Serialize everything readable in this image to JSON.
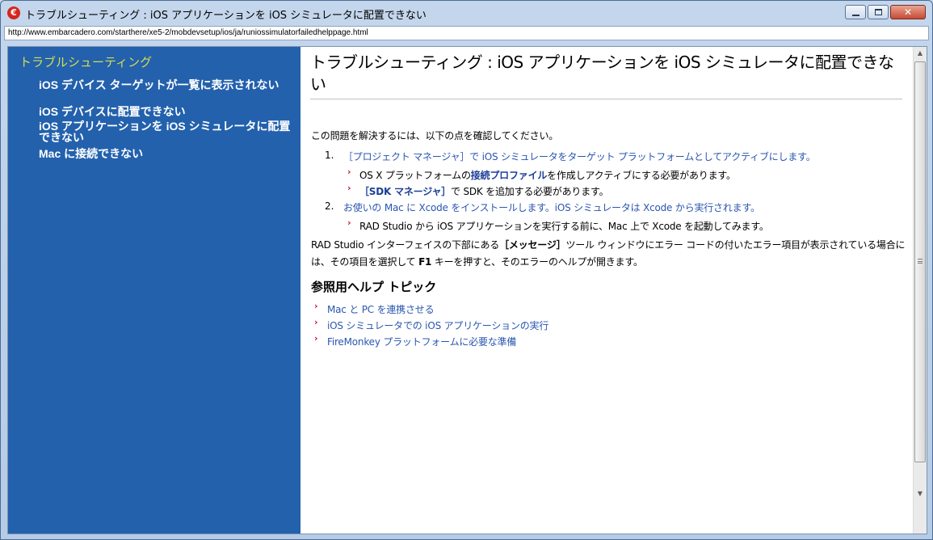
{
  "window": {
    "title": "トラブルシューティング : iOS アプリケーションを iOS シミュレータに配置できない",
    "address": "http://www.embarcadero.com/starthere/xe5-2/mobdevsetup/ios/ja/runiossimulatorfailedhelppage.html",
    "app_icon_glyph": "€",
    "minimize_label": "",
    "maximize_label": "",
    "close_label": "✕"
  },
  "sidebar": {
    "title": "トラブルシューティング",
    "items": [
      {
        "label": "iOS デバイス ターゲットが一覧に表示されない"
      },
      {
        "label": "iOS デバイスに配置できない"
      },
      {
        "label": "iOS アプリケーションを iOS シミュレータに配置できない"
      },
      {
        "label": "Mac に接続できない"
      }
    ],
    "colors": {
      "background": "#2361ad",
      "title": "#d5dd52",
      "items": "#ffffff"
    }
  },
  "main": {
    "page_title": "トラブルシューティング : iOS アプリケーションを iOS シミュレータに配置できない",
    "intro": "この問題を解決するには、以下の点を確認してください。",
    "steps": [
      {
        "number": "1.",
        "text": "［プロジェクト マネージャ］で iOS シミュレータをターゲット プラットフォームとしてアクティブにします。",
        "subitems": [
          {
            "prefix": "OS X プラットフォームの",
            "link": "接続プロファイル",
            "suffix": "を作成しアクティブにする必要があります。"
          },
          {
            "prefix": "",
            "link": "［SDK マネージャ］",
            "suffix": "で SDK を追加する必要があります。"
          }
        ]
      },
      {
        "number": "2.",
        "text": "お使いの Mac に Xcode をインストールします。iOS シミュレータは Xcode から実行されます。",
        "subitems": [
          {
            "prefix": "RAD Studio から iOS アプリケーションを実行する前に、Mac 上で Xcode を起動してみます。",
            "link": "",
            "suffix": ""
          }
        ]
      }
    ],
    "note": {
      "line1_a": "RAD Studio インターフェイスの下部にある",
      "line1_bold": "［メッセージ］",
      "line1_b": "ツール ウィンドウにエラー コードの付いたエラー項目が表示されている場合に",
      "line2_a": "は、その項目を選択して ",
      "line2_bold": "F1",
      "line2_b": " キーを押すと、そのエラーのヘルプが開きます。"
    },
    "related_heading": "参照用ヘルプ トピック",
    "related_links": [
      {
        "label": "Mac と PC を連携させる"
      },
      {
        "label": "iOS シミュレータでの iOS アプリケーションの実行"
      },
      {
        "label": "FireMonkey プラットフォームに必要な準備"
      }
    ],
    "bullet_glyph": "›",
    "colors": {
      "link": "#2a56b0",
      "bullet": "#c8102e"
    }
  },
  "scrollbar": {
    "up_arrow": "▲",
    "down_arrow": "▼"
  }
}
